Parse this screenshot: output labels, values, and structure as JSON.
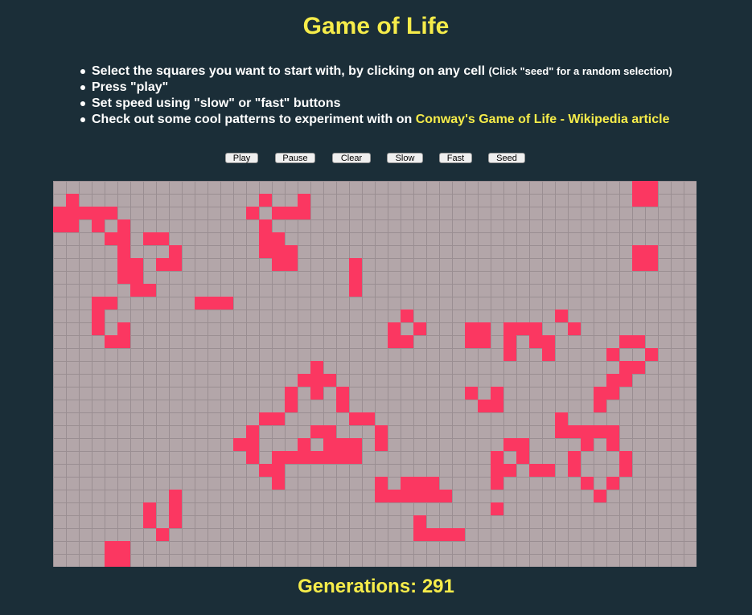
{
  "title": "Game of Life",
  "instructions": {
    "line1": "Select the squares you want to start with, by clicking on any cell",
    "line1_small": "(Click \"seed\" for a random selection)",
    "line2": "Press \"play\"",
    "line3": "Set speed using \"slow\" or \"fast\" buttons",
    "line4_prefix": "Check out some cool patterns to experiment with on",
    "line4_link": "Conway's Game of Life - Wikipedia article"
  },
  "buttons": {
    "play": "Play",
    "pause": "Pause",
    "clear": "Clear",
    "slow": "Slow",
    "fast": "Fast",
    "seed": "Seed"
  },
  "board": {
    "columns": 50,
    "rows": 30,
    "live_color": "#fb3761",
    "dead_color": "#b3a6a9",
    "grid_color": "#9a8e92",
    "live_cells": [
      [
        0,
        45
      ],
      [
        0,
        46
      ],
      [
        1,
        1
      ],
      [
        1,
        16
      ],
      [
        1,
        19
      ],
      [
        1,
        45
      ],
      [
        1,
        46
      ],
      [
        2,
        0
      ],
      [
        2,
        1
      ],
      [
        2,
        2
      ],
      [
        2,
        3
      ],
      [
        2,
        4
      ],
      [
        2,
        15
      ],
      [
        2,
        17
      ],
      [
        2,
        18
      ],
      [
        2,
        19
      ],
      [
        3,
        0
      ],
      [
        3,
        1
      ],
      [
        3,
        3
      ],
      [
        3,
        5
      ],
      [
        3,
        16
      ],
      [
        4,
        4
      ],
      [
        4,
        5
      ],
      [
        4,
        7
      ],
      [
        4,
        8
      ],
      [
        4,
        16
      ],
      [
        4,
        17
      ],
      [
        5,
        5
      ],
      [
        5,
        9
      ],
      [
        5,
        16
      ],
      [
        5,
        17
      ],
      [
        5,
        18
      ],
      [
        5,
        45
      ],
      [
        5,
        46
      ],
      [
        6,
        5
      ],
      [
        6,
        6
      ],
      [
        6,
        8
      ],
      [
        6,
        9
      ],
      [
        6,
        17
      ],
      [
        6,
        18
      ],
      [
        6,
        23
      ],
      [
        6,
        45
      ],
      [
        6,
        46
      ],
      [
        7,
        5
      ],
      [
        7,
        6
      ],
      [
        7,
        23
      ],
      [
        8,
        6
      ],
      [
        8,
        7
      ],
      [
        8,
        23
      ],
      [
        9,
        3
      ],
      [
        9,
        4
      ],
      [
        9,
        11
      ],
      [
        9,
        12
      ],
      [
        9,
        13
      ],
      [
        10,
        3
      ],
      [
        10,
        27
      ],
      [
        10,
        39
      ],
      [
        11,
        3
      ],
      [
        11,
        5
      ],
      [
        11,
        26
      ],
      [
        11,
        28
      ],
      [
        11,
        32
      ],
      [
        11,
        33
      ],
      [
        11,
        35
      ],
      [
        11,
        36
      ],
      [
        11,
        37
      ],
      [
        11,
        40
      ],
      [
        12,
        4
      ],
      [
        12,
        5
      ],
      [
        12,
        26
      ],
      [
        12,
        27
      ],
      [
        12,
        32
      ],
      [
        12,
        33
      ],
      [
        12,
        35
      ],
      [
        12,
        37
      ],
      [
        12,
        38
      ],
      [
        12,
        44
      ],
      [
        12,
        45
      ],
      [
        13,
        35
      ],
      [
        13,
        38
      ],
      [
        13,
        43
      ],
      [
        13,
        46
      ],
      [
        14,
        20
      ],
      [
        14,
        44
      ],
      [
        14,
        45
      ],
      [
        15,
        19
      ],
      [
        15,
        20
      ],
      [
        15,
        21
      ],
      [
        15,
        43
      ],
      [
        15,
        44
      ],
      [
        16,
        18
      ],
      [
        16,
        20
      ],
      [
        16,
        22
      ],
      [
        16,
        32
      ],
      [
        16,
        34
      ],
      [
        16,
        42
      ],
      [
        16,
        43
      ],
      [
        17,
        18
      ],
      [
        17,
        22
      ],
      [
        17,
        33
      ],
      [
        17,
        34
      ],
      [
        17,
        42
      ],
      [
        18,
        16
      ],
      [
        18,
        17
      ],
      [
        18,
        23
      ],
      [
        18,
        24
      ],
      [
        18,
        39
      ],
      [
        19,
        15
      ],
      [
        19,
        20
      ],
      [
        19,
        21
      ],
      [
        19,
        25
      ],
      [
        19,
        39
      ],
      [
        19,
        40
      ],
      [
        19,
        41
      ],
      [
        19,
        42
      ],
      [
        19,
        43
      ],
      [
        20,
        14
      ],
      [
        20,
        15
      ],
      [
        20,
        19
      ],
      [
        20,
        21
      ],
      [
        20,
        22
      ],
      [
        20,
        23
      ],
      [
        20,
        25
      ],
      [
        20,
        35
      ],
      [
        20,
        36
      ],
      [
        20,
        41
      ],
      [
        20,
        43
      ],
      [
        21,
        15
      ],
      [
        21,
        17
      ],
      [
        21,
        18
      ],
      [
        21,
        19
      ],
      [
        21,
        20
      ],
      [
        21,
        21
      ],
      [
        21,
        22
      ],
      [
        21,
        23
      ],
      [
        21,
        34
      ],
      [
        21,
        36
      ],
      [
        21,
        40
      ],
      [
        21,
        44
      ],
      [
        22,
        16
      ],
      [
        22,
        17
      ],
      [
        22,
        34
      ],
      [
        22,
        35
      ],
      [
        22,
        37
      ],
      [
        22,
        38
      ],
      [
        22,
        40
      ],
      [
        22,
        44
      ],
      [
        23,
        17
      ],
      [
        23,
        25
      ],
      [
        23,
        27
      ],
      [
        23,
        28
      ],
      [
        23,
        29
      ],
      [
        23,
        34
      ],
      [
        23,
        41
      ],
      [
        23,
        43
      ],
      [
        24,
        9
      ],
      [
        24,
        25
      ],
      [
        24,
        26
      ],
      [
        24,
        27
      ],
      [
        24,
        28
      ],
      [
        24,
        29
      ],
      [
        24,
        30
      ],
      [
        24,
        42
      ],
      [
        25,
        7
      ],
      [
        25,
        9
      ],
      [
        25,
        34
      ],
      [
        26,
        7
      ],
      [
        26,
        9
      ],
      [
        26,
        28
      ],
      [
        27,
        8
      ],
      [
        27,
        28
      ],
      [
        27,
        29
      ],
      [
        27,
        30
      ],
      [
        27,
        31
      ],
      [
        28,
        4
      ],
      [
        28,
        5
      ],
      [
        29,
        4
      ],
      [
        29,
        5
      ]
    ]
  },
  "status": {
    "generations_label": "Generations:",
    "generations_value": "291"
  }
}
